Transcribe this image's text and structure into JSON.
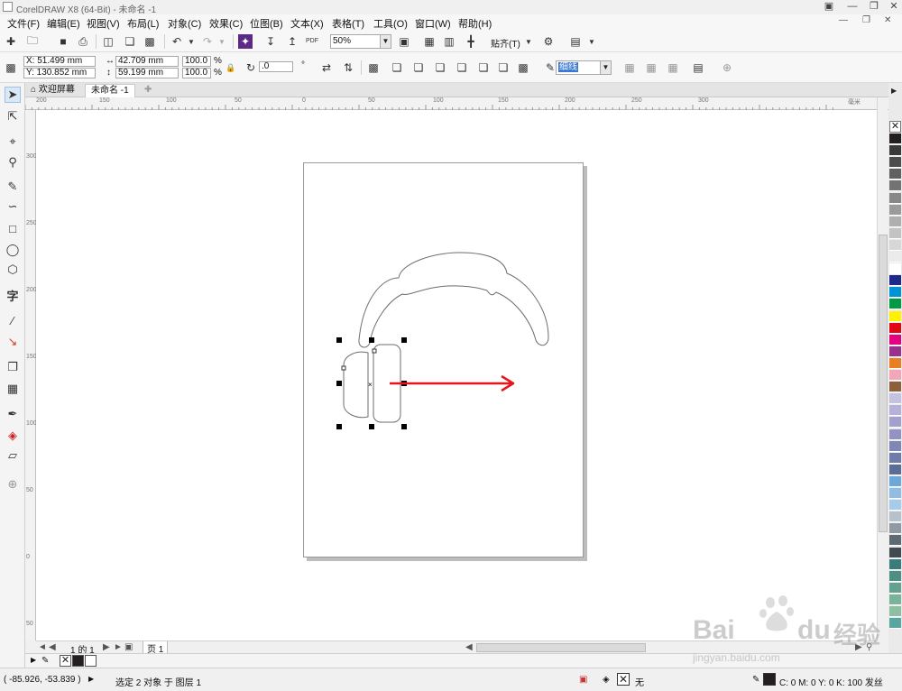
{
  "window": {
    "title": "CorelDRAW X8 (64-Bit) - 未命名 -1"
  },
  "menu": [
    "文件(F)",
    "编辑(E)",
    "视图(V)",
    "布局(L)",
    "对象(C)",
    "效果(C)",
    "位图(B)",
    "文本(X)",
    "表格(T)",
    "工具(O)",
    "窗口(W)",
    "帮助(H)"
  ],
  "toolbar": {
    "zoom": "50%",
    "snap_label": "贴齐(T)"
  },
  "propbar": {
    "x": "X: 51.499 mm",
    "y": "Y: 130.852 mm",
    "width": "42.709 mm",
    "height": "59.199 mm",
    "scale_w": "100.0",
    "scale_h": "100.0",
    "percent": "%",
    "rotation": ".0",
    "outline": "细线"
  },
  "tabs": {
    "welcome": "欢迎屏幕",
    "doc": "未命名 -1"
  },
  "ruler": {
    "h": [
      "200",
      "150",
      "100",
      "50",
      "0",
      "50",
      "100",
      "150",
      "200",
      "250",
      "300"
    ],
    "v": [
      "300",
      "250",
      "200",
      "150",
      "100",
      "50",
      "0",
      "50"
    ],
    "unit": "毫米"
  },
  "pagenav": {
    "counter": "1 的 1",
    "page_tab": "页 1"
  },
  "status": {
    "coords": "( -85.926, -53.839 )",
    "selection": "选定 2 对象 于 图层 1",
    "fill": "无",
    "outline_color": "C: 0 M: 0 Y: 0 K: 100  发丝"
  },
  "watermark": {
    "brand": "Bai",
    "brand2": "du",
    "cn": "经验",
    "url": "jingyan.baidu.com"
  },
  "colors": {
    "accent_red": "#e8141b",
    "palette": [
      "#231f20",
      "#3a3a3a",
      "#4d4d4d",
      "#606060",
      "#737373",
      "#878787",
      "#9b9b9b",
      "#afafaf",
      "#c3c3c3",
      "#d7d7d7",
      "#ebebeb",
      "#ffffff",
      "#1d2a8c",
      "#0093d6",
      "#009a44",
      "#fff100",
      "#e30613",
      "#e4007f",
      "#9b2f8e",
      "#e97e23",
      "#f3a6b6",
      "#8f5f3b",
      "#c4c2e0",
      "#b5b1d8",
      "#a3a0d0",
      "#9292c4",
      "#7e87b6",
      "#6f7ba8",
      "#5a6d97",
      "#6ca8d9",
      "#8fbde3",
      "#a7cce9",
      "#b6c2cb",
      "#8f9ba4",
      "#5d6a73",
      "#424b52",
      "#3a7b7b",
      "#4f8e83",
      "#64a18f",
      "#79b39a",
      "#8ebfa4",
      "#57a6a0"
    ]
  }
}
